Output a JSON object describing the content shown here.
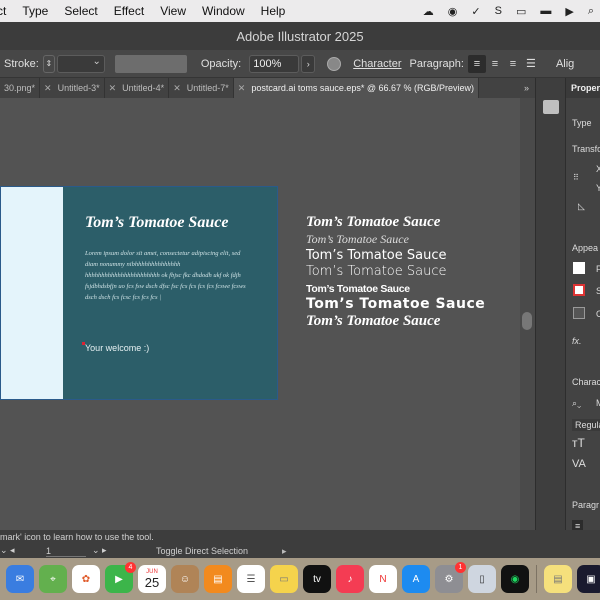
{
  "menubar": {
    "items": [
      "ct",
      "Type",
      "Select",
      "Effect",
      "View",
      "Window",
      "Help"
    ]
  },
  "window": {
    "title": "Adobe Illustrator 2025"
  },
  "controlbar": {
    "stroke_label": "Stroke:",
    "opacity_label": "Opacity:",
    "opacity_value": "100%",
    "character_link": "Character",
    "paragraph_label": "Paragraph:",
    "align_label": "Alig"
  },
  "tabs": [
    {
      "label": "30.png*"
    },
    {
      "label": "Untitled-3*"
    },
    {
      "label": "Untitled-4*"
    },
    {
      "label": "Untitled-7*"
    },
    {
      "label": "postcard.ai toms sauce.eps* @ 66.67 % (RGB/Preview)"
    }
  ],
  "tabs_more": "»",
  "artboard": {
    "title": "Tom’s Tomatoe Sauce",
    "body": "Lorem ipsum dolor sit amet, consectetur adipiscing elit, sed diam nonummy nibhhhhhhhhhhhhhh hhhhhhhhhhhhhhhhhhhhhhh ok fbjsc  fkc dhdodh ukf ok fdjh fsjdbhdsbfjn  uo fcs fsw dsch dfsc fsc fcs fcs fcs fcs fcswe fcsws dsch dsch fcs fcsc fcs fcs fcs |",
    "welcome": "Your welcome :)"
  },
  "variants": [
    "Tom’s Tomatoe Sauce",
    "Tom’s Tomatoe Sauce",
    "Tom’s Tomatoe Sauce",
    "Tom’s Tomatoe Sauce",
    "Tom’s Tomatoe Sauce",
    "Tom’s Tomatoe Sauce",
    "Tom’s Tomatoe Sauce"
  ],
  "right_panel": {
    "header": "Propert",
    "type": "Type",
    "transform": "Transfo",
    "x": "X",
    "y": "Y",
    "appearance": "Appea",
    "fill": "F",
    "stroke": "S",
    "opacity": "O",
    "fx": "fx.",
    "character": "Characte",
    "font": "M",
    "style": "Regula",
    "paragraph": "Paragr"
  },
  "statusbar": {
    "hint": "mark' icon to learn how to use the tool.",
    "artboard_num": "1",
    "toggle": "Toggle Direct Selection",
    "arrow": "▸"
  },
  "dock": {
    "calendar_month": "JUN",
    "calendar_day": "25",
    "facetime_badge": "4",
    "settings_badge": "1"
  },
  "colors": {
    "artboard_teal": "#2c5e69",
    "artboard_light": "#e4f4fb",
    "canvas_gray": "#535353"
  }
}
